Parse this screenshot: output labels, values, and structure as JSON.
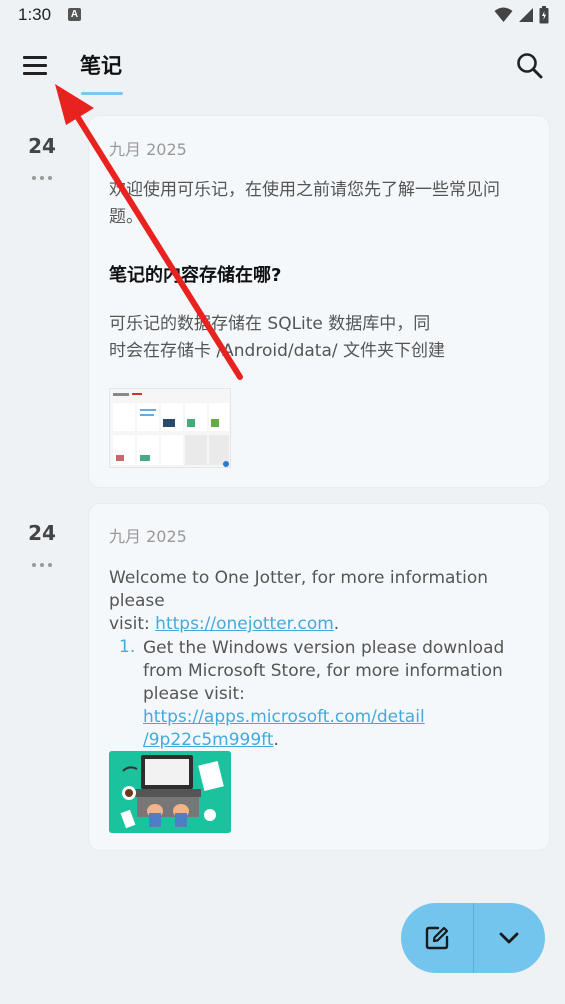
{
  "status_bar": {
    "time": "1:30",
    "notification_glyph": "A",
    "icons": [
      "wifi-icon",
      "signal-icon",
      "battery-icon"
    ]
  },
  "app_bar": {
    "tab_label": "笔记",
    "accent_color": "#7cc7ef",
    "icons": [
      "menu-icon",
      "search-icon"
    ]
  },
  "notes": [
    {
      "day": "24",
      "date": "九月 2025",
      "paragraph_1_line_1": "欢迎使用可乐记，在使用之前请您先了解一些常见问",
      "paragraph_1_line_2": "题。",
      "heading": "笔记的内容存储在哪?",
      "paragraph_2_line_1": "可乐记的数据存储在 SQLite 数据库中，同",
      "paragraph_2_line_2": "时会在存储卡 /Android/data/ 文件夹下创建"
    },
    {
      "day": "24",
      "date": "九月 2025",
      "intro_line_1": "Welcome to One Jotter, for more information please",
      "intro_prefix": "visit: ",
      "intro_link": "https://onejotter.com",
      "intro_suffix": ".",
      "list_number": "1.",
      "item_line_1": "Get the Windows version please download",
      "item_line_2": "from Microsoft Store, for more information",
      "item_prefix": "please visit: ",
      "item_link_1": "https://apps.microsoft.com/detail",
      "item_link_2": "/9p22c5m999ft",
      "item_suffix": "."
    }
  ],
  "fab": {
    "color": "#74c5ee",
    "icons": [
      "edit-note-icon",
      "chevron-down-icon"
    ]
  }
}
